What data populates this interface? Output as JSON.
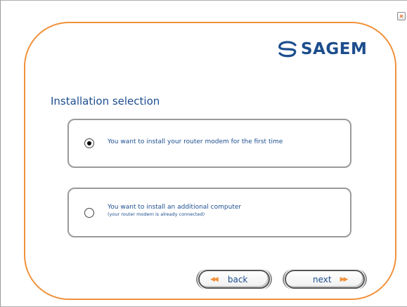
{
  "window": {
    "close_glyph": "×"
  },
  "brand": {
    "logo_text": "SAGEM",
    "logo_icon": "sagem-swirl-icon",
    "color": "#1c4d8c"
  },
  "accent_color": "#f0913a",
  "section": {
    "title": "Installation selection"
  },
  "options": [
    {
      "label": "You want to install your router modem for the first time",
      "sublabel": "",
      "selected": true
    },
    {
      "label": "You want to install an additional computer",
      "sublabel": "(your router modem is already connected)",
      "selected": false
    }
  ],
  "nav": {
    "back_label": "back",
    "back_icon": "double-left-arrow-icon",
    "back_glyph": "◀◀",
    "next_label": "next",
    "next_icon": "double-right-arrow-icon",
    "next_glyph": "▶▶"
  }
}
